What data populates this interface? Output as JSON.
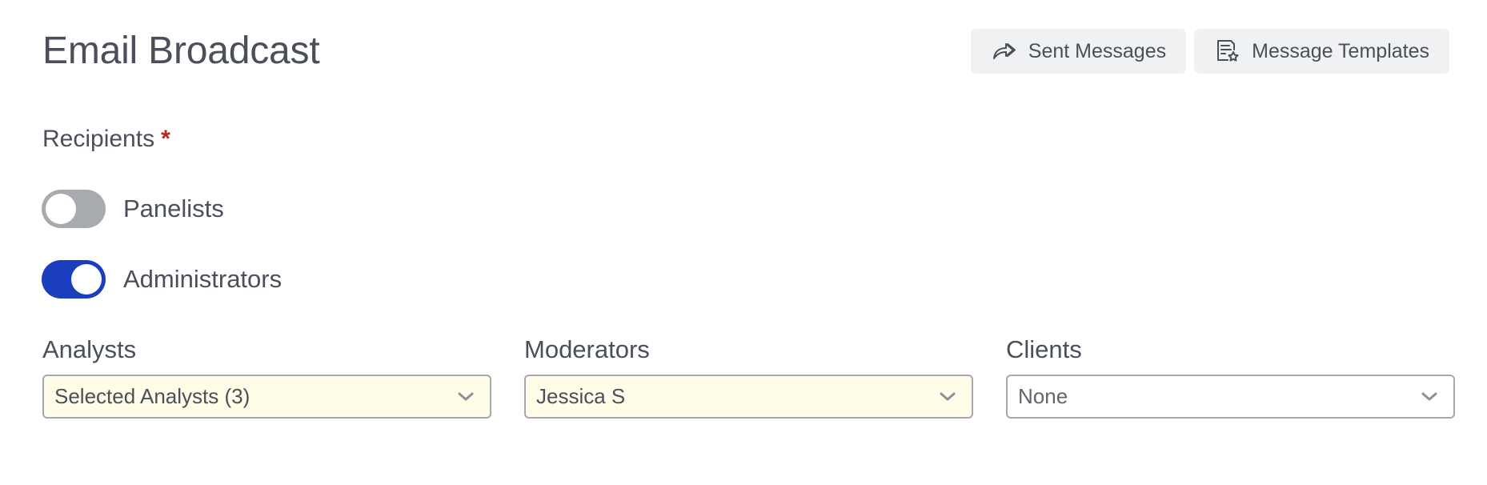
{
  "header": {
    "title": "Email Broadcast",
    "actions": [
      {
        "label": "Sent Messages",
        "icon": "share-forward-icon"
      },
      {
        "label": "Message Templates",
        "icon": "template-star-icon"
      }
    ]
  },
  "recipients": {
    "label": "Recipients",
    "required_mark": "*",
    "toggles": [
      {
        "label": "Panelists",
        "checked": false
      },
      {
        "label": "Administrators",
        "checked": true
      }
    ]
  },
  "selects": [
    {
      "label": "Analysts",
      "value": "Selected Analysts (3)",
      "highlighted": true,
      "icon": "chevron-down-icon"
    },
    {
      "label": "Moderators",
      "value": "Jessica S",
      "highlighted": true,
      "icon": "chevron-down-icon"
    },
    {
      "label": "Clients",
      "value": "None",
      "highlighted": false,
      "icon": "chevron-down-icon"
    }
  ],
  "colors": {
    "text": "#4a4f5a",
    "toggle_on": "#1b3ebe",
    "toggle_off": "#a7aaaf",
    "required": "#b3261e",
    "select_highlight_bg": "#fffde8",
    "button_bg": "#f0f1f2"
  }
}
